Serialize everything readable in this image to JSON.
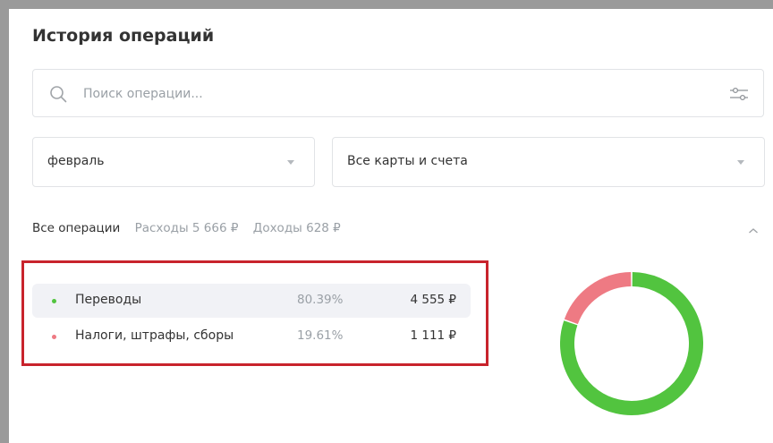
{
  "header": {
    "title": "История операций"
  },
  "search": {
    "placeholder": "Поиск операции...",
    "icon": "search-icon",
    "filter_icon": "filter-sliders-icon"
  },
  "filters": {
    "month": {
      "value": "февраль"
    },
    "cards": {
      "value": "Все карты и счета"
    }
  },
  "tabs": {
    "all": "Все операции",
    "expenses": "Расходы 5 666 ₽",
    "income": "Доходы 628 ₽"
  },
  "categories": [
    {
      "name": "Переводы",
      "percent": "80.39%",
      "amount": "4 555 ₽",
      "color": "#52c43f",
      "share": 0.8039
    },
    {
      "name": "Налоги, штрафы, сборы",
      "percent": "19.61%",
      "amount": "1 111 ₽",
      "color": "#ee7a83",
      "share": 0.1961
    }
  ],
  "colors": {
    "highlight_border": "#c8232c",
    "green": "#52c43f",
    "pink": "#ee7a83"
  }
}
